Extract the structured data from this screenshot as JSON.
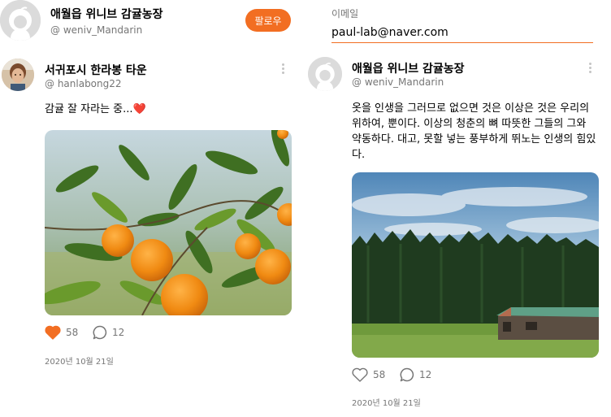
{
  "left_column": {
    "top_profile": {
      "name": "애월읍 위니브 감귤농장",
      "handle": "@ weniv_Mandarin",
      "follow_label": "팔로우"
    },
    "post": {
      "author_name": "서귀포시 한라봉 타운",
      "author_handle": "@ hanlabong22",
      "text": "감귤 잘 자라는 중...❤️",
      "likes": "58",
      "comments": "12",
      "date": "2020년 10월 21일",
      "liked": true
    }
  },
  "right_column": {
    "email": {
      "label": "이메일",
      "value": "paul-lab@naver.com"
    },
    "post": {
      "author_name": "애월읍 위니브 감귤농장",
      "author_handle": "@ weniv_Mandarin",
      "text": "옷을 인생을 그러므로 없으면 것은 이상은 것은 우리의 위하여, 뿐이다. 이상의 청춘의 뼈 따뜻한 그들의 그와 약동하다. 대고, 못할 넣는 풍부하게 뛰노는 인생의 힘있다.",
      "likes": "58",
      "comments": "12",
      "date": "2020년 10월 21일",
      "liked": false
    }
  },
  "colors": {
    "accent": "#f26e22",
    "text_secondary": "#767676",
    "avatar_gray": "#dbdbdb"
  },
  "icons": [
    "more-vertical-icon",
    "heart-icon",
    "comment-icon",
    "default-avatar-icon"
  ]
}
